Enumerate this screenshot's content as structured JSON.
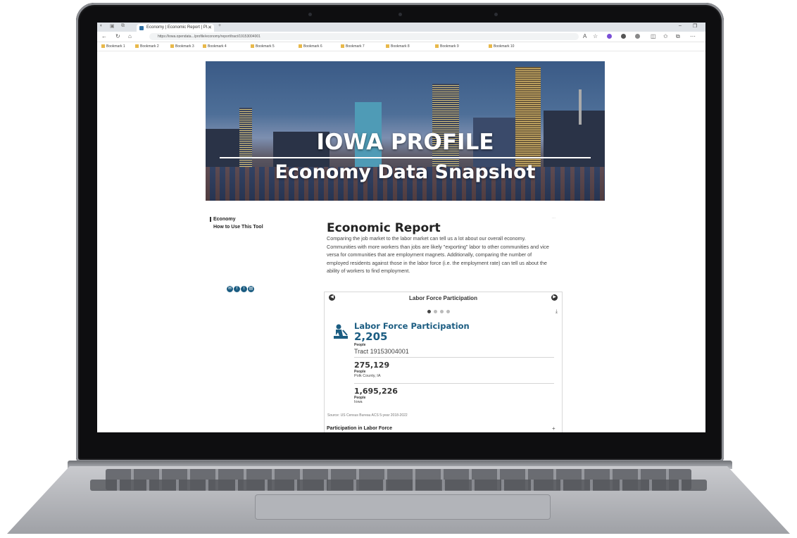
{
  "browser": {
    "tab_title": "Economy | Economic Report | Pl...",
    "url": "https://iowa.opendata.../profile/economy/report/tract/19153004001",
    "bookmarks": [
      "Bookmark 1",
      "Bookmark 2",
      "Bookmark 3",
      "Bookmark 4",
      "Bookmark 5",
      "Bookmark 6",
      "Bookmark 7",
      "Bookmark 8",
      "Bookmark 9",
      "Bookmark 10"
    ]
  },
  "banner": {
    "title": "IOWA PROFILE",
    "subtitle": "Economy Data Snapshot"
  },
  "sidebar": {
    "items": [
      {
        "label": "Economy",
        "active": true
      },
      {
        "label": "How to Use This Tool",
        "active": false
      }
    ]
  },
  "report": {
    "title": "Economic Report",
    "body": "Comparing the job market to the labor market can tell us a lot about our overall economy. Communities with more workers than jobs are likely \"exporting\" labor to other communities and vice versa for communities that are employment magnets. Additionally, comparing the number of employed residents against those in the labor force (i.e. the employment rate) can tell us about the ability of workers to find employment."
  },
  "carousel": {
    "heading": "Labor Force Participation",
    "slide_count": 4,
    "active_slide": 0
  },
  "metric": {
    "title": "Labor Force Participation",
    "value": "2,205",
    "unit": "People",
    "location": "Tract 19153004001",
    "comparisons": [
      {
        "value": "275,129",
        "unit": "People",
        "location": "Polk County, IA"
      },
      {
        "value": "1,695,226",
        "unit": "People",
        "location": "Iowa"
      }
    ],
    "source": "Source: US Census Bureau ACS 5-year 2018-2022"
  },
  "next_section": {
    "title": "Participation in Labor Force"
  }
}
